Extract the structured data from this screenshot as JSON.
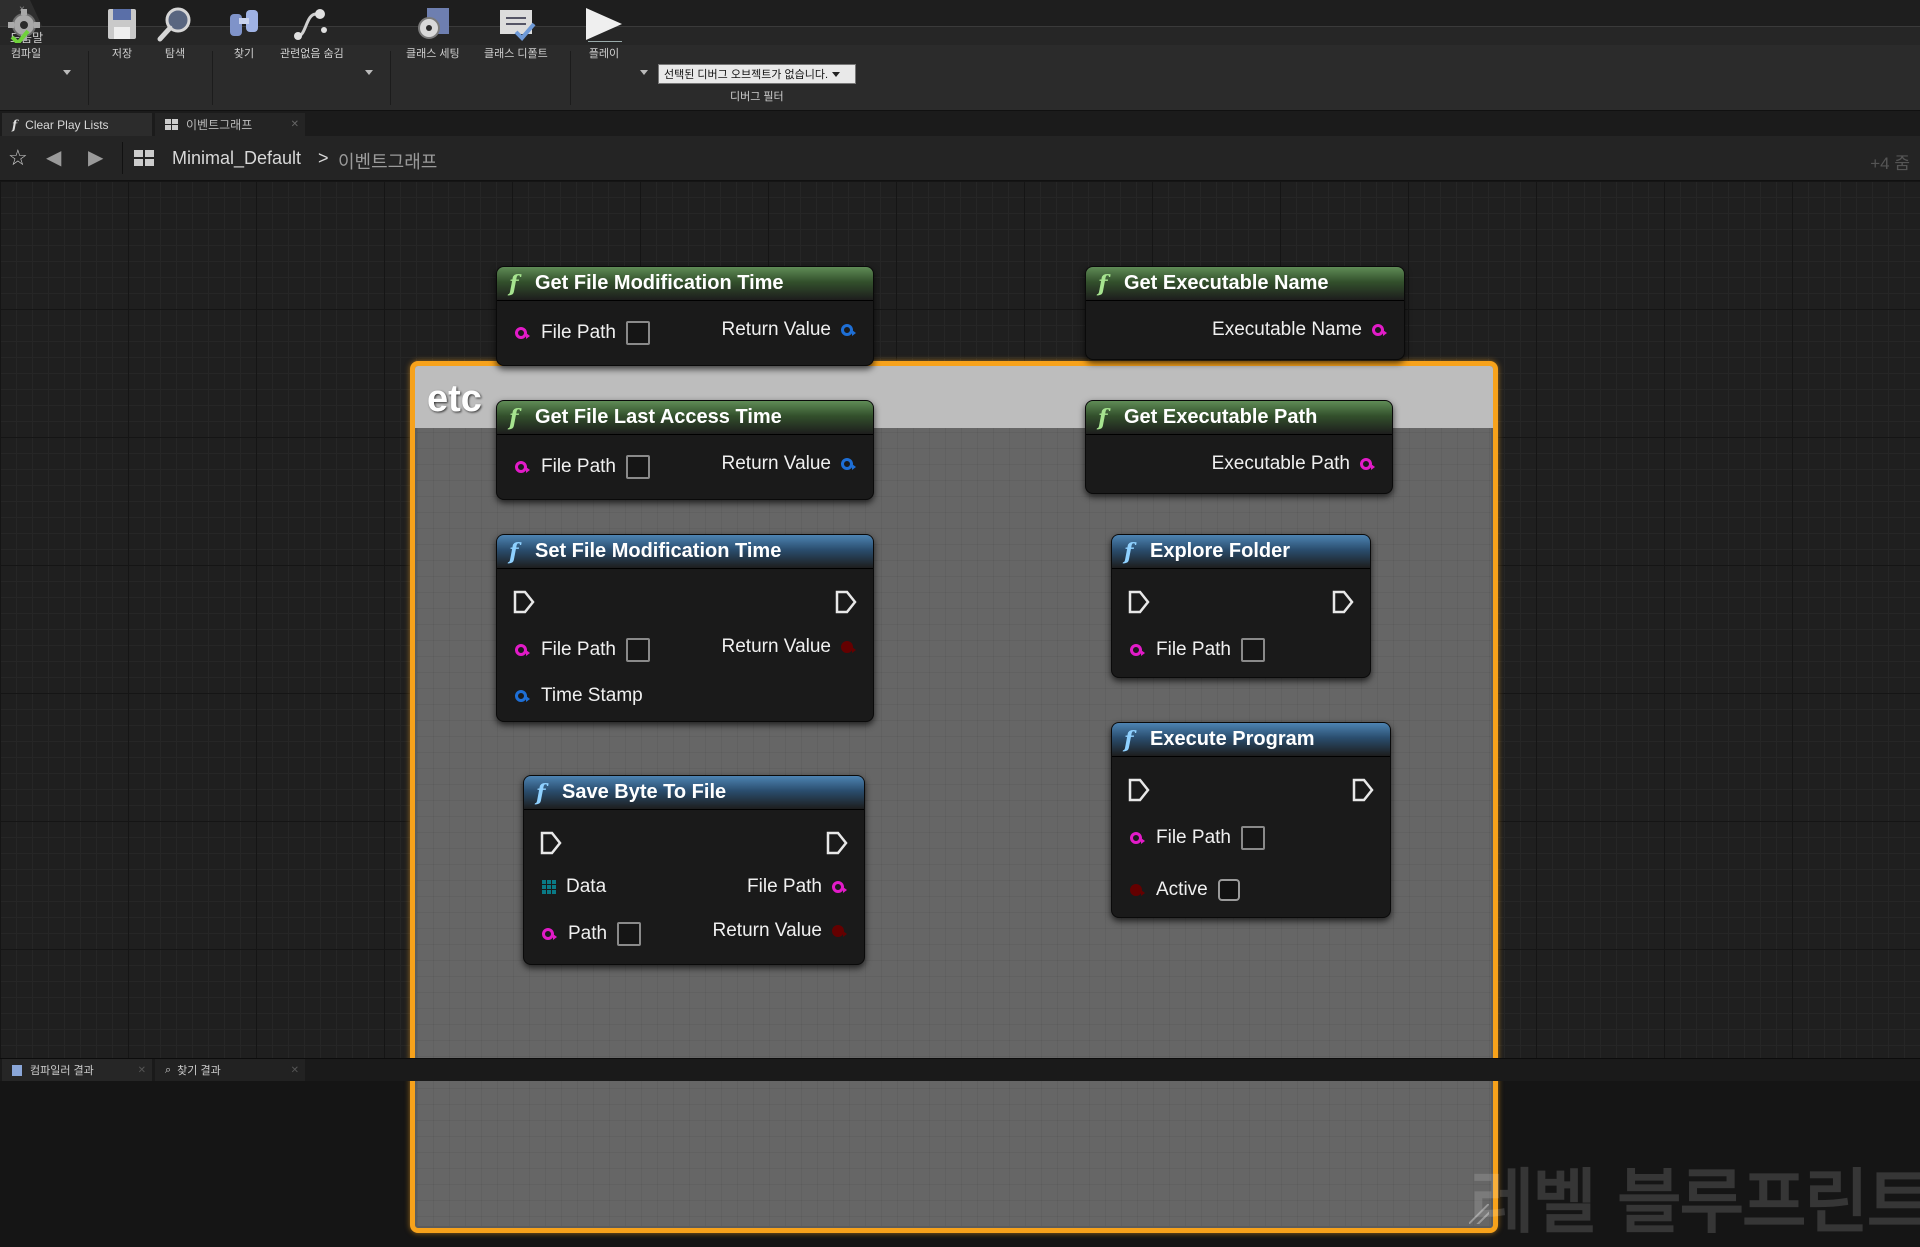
{
  "window": {
    "close_glyph": "×"
  },
  "menu": {
    "help": "도움말"
  },
  "toolbar": {
    "compile": "컴파일",
    "save": "저장",
    "browse": "탐색",
    "find": "찾기",
    "hide_unrelated": "관련없음 숨김",
    "class_settings": "클래스 세팅",
    "class_defaults": "클래스 디폴트",
    "play": "플레이",
    "debug_selector": "선택된 디버그 오브젝트가 없습니다.",
    "debug_filter": "디버그 필터"
  },
  "tabs": [
    {
      "label": "Clear Play Lists",
      "icon": "function-icon"
    },
    {
      "label": "이벤트그래프",
      "icon": "graph-icon"
    }
  ],
  "breadcrumb": {
    "root": "Minimal_Default",
    "separator": ">",
    "current": "이벤트그래프",
    "zoom": "+4 줌"
  },
  "comment": {
    "title": "etc"
  },
  "nodes": {
    "get_file_mod_time": {
      "title": "Get File Modification Time",
      "in": "File Path",
      "out": "Return Value"
    },
    "get_file_access_time": {
      "title": "Get File Last Access Time",
      "in": "File Path",
      "out": "Return Value"
    },
    "set_file_mod_time": {
      "title": "Set File Modification Time",
      "in1": "File Path",
      "in2": "Time Stamp",
      "out": "Return Value"
    },
    "save_byte": {
      "title": "Save Byte To File",
      "in1": "Data",
      "in2": "Path",
      "out1": "File Path",
      "out2": "Return Value"
    },
    "get_exe_name": {
      "title": "Get Executable Name",
      "out": "Executable Name"
    },
    "get_exe_path": {
      "title": "Get Executable Path",
      "out": "Executable Path"
    },
    "explore_folder": {
      "title": "Explore Folder",
      "in": "File Path"
    },
    "execute_program": {
      "title": "Execute Program",
      "in1": "File Path",
      "in2": "Active"
    }
  },
  "bottom_tabs": [
    {
      "label": "컴파일러 결과"
    },
    {
      "label": "찾기 결과"
    }
  ],
  "watermark": "레벨 블루프린트",
  "colors": {
    "comment_border": "#f7a21b",
    "pin_string": "#e21bc8",
    "pin_float": "#1e6fd6",
    "pin_bool": "#8a0000",
    "pure_header": "#5f8c56",
    "impure_header": "#4d84b3"
  }
}
